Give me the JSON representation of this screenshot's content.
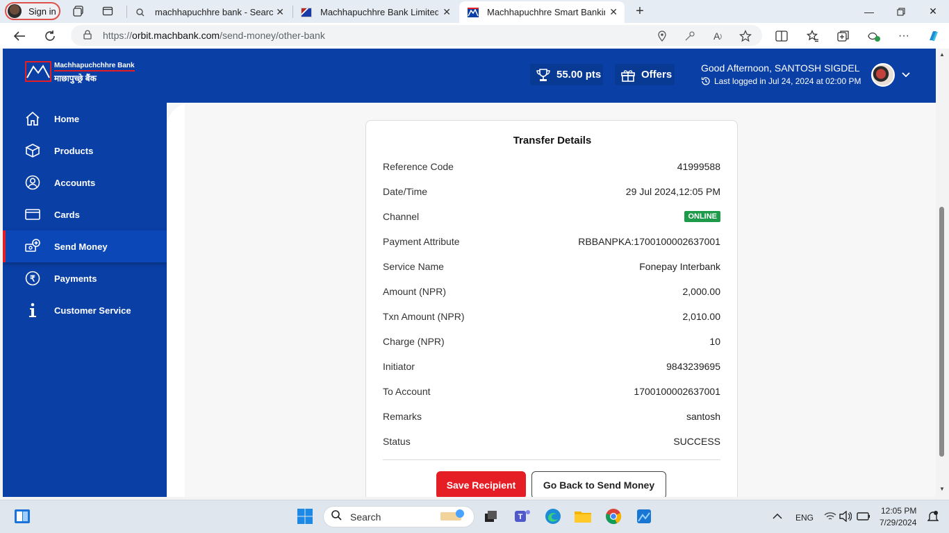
{
  "browser": {
    "profile_label": "Sign in",
    "tabs": [
      {
        "title": "machhapuchhre bank - Search"
      },
      {
        "title": "Machhapuchhre Bank Limited"
      },
      {
        "title": "Machhapuchhre Smart Banking"
      }
    ],
    "url_prefix": "https://",
    "url_host": "orbit.machbank.com",
    "url_path": "/send-money/other-bank"
  },
  "header": {
    "logo_line1": "Machhapuchchhre Bank",
    "logo_line2": "माछापुच्छ्रे बैंक",
    "points": "55.00 pts",
    "offers": "Offers",
    "greeting": "Good Afternoon, SANTOSH SIGDEL",
    "last_logged": "Last logged in Jul 24, 2024 at 02:00 PM"
  },
  "sidebar": {
    "items": [
      {
        "label": "Home"
      },
      {
        "label": "Products"
      },
      {
        "label": "Accounts"
      },
      {
        "label": "Cards"
      },
      {
        "label": "Send Money"
      },
      {
        "label": "Payments"
      },
      {
        "label": "Customer Service"
      }
    ]
  },
  "transfer": {
    "title": "Transfer Details",
    "rows": [
      {
        "key": "Reference Code",
        "value": "41999588"
      },
      {
        "key": "Date/Time",
        "value": "29 Jul 2024,12:05 PM"
      },
      {
        "key": "Channel",
        "value": "ONLINE"
      },
      {
        "key": "Payment Attribute",
        "value": "RBBANPKA:1700100002637001"
      },
      {
        "key": "Service Name",
        "value": "Fonepay Interbank"
      },
      {
        "key": "Amount (NPR)",
        "value": "2,000.00"
      },
      {
        "key": "Txn Amount (NPR)",
        "value": "2,010.00"
      },
      {
        "key": "Charge (NPR)",
        "value": "10"
      },
      {
        "key": "Initiator",
        "value": "9843239695"
      },
      {
        "key": "To Account",
        "value": "1700100002637001"
      },
      {
        "key": "Remarks",
        "value": "santosh"
      },
      {
        "key": "Status",
        "value": "SUCCESS"
      }
    ],
    "save_button": "Save Recipient",
    "back_button": "Go Back to Send Money"
  },
  "taskbar": {
    "search_label": "Search",
    "lang": "ENG",
    "time": "12:05 PM",
    "date": "7/29/2024"
  },
  "colors": {
    "brand_blue": "#0a3fa6",
    "brand_red": "#e51d25",
    "online_green": "#1e9b4a"
  }
}
